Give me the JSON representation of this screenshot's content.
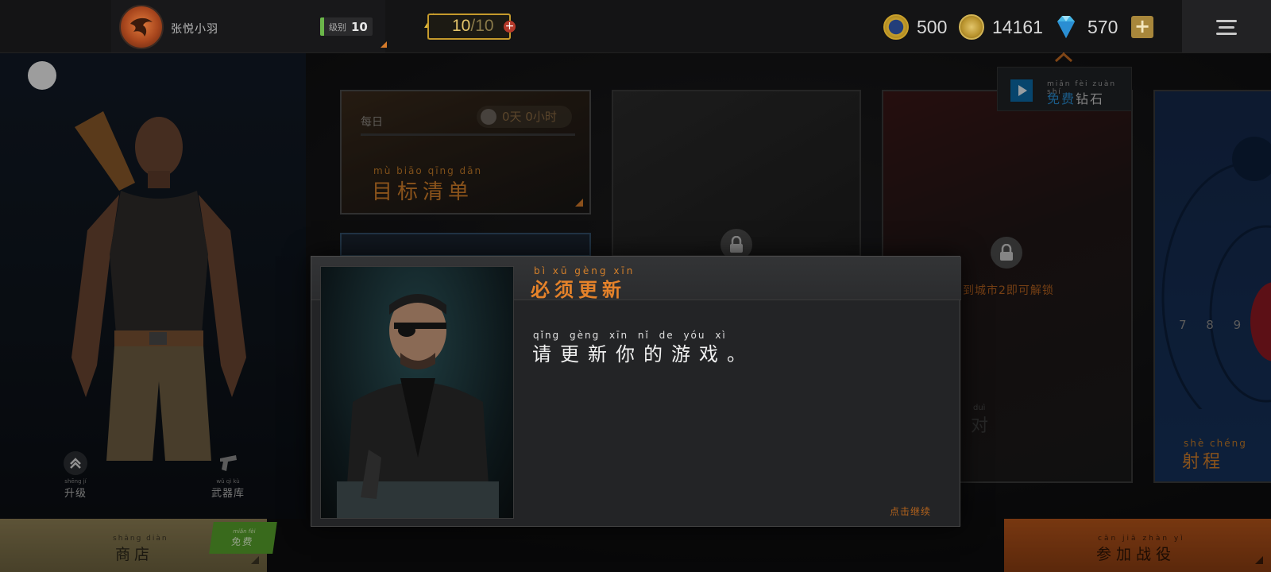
{
  "topbar": {
    "username": "张悦小羽",
    "level_label": "级别",
    "level_value": "10",
    "energy_current": "10",
    "energy_sep": "/",
    "energy_max": "10",
    "currency_skull": "500",
    "currency_gold": "14161",
    "currency_gems": "570",
    "add_label": "+"
  },
  "free_gems": {
    "pinyin": "miǎn fèi  zuàn shí",
    "free": "免费",
    "gem": "钻石"
  },
  "left_panel": {
    "upgrade_pinyin": "shēng jí",
    "upgrade_label": "升级",
    "armory_pinyin": "wǔ qì kù",
    "armory_label": "武器库"
  },
  "cards": {
    "targets_daily": "每日",
    "targets_timer": "0天 0小时",
    "targets_pinyin": "mù biāo qīng dān",
    "targets_title": "目标清单",
    "sniper_unlock": "到城市2即可解锁",
    "sniper_dui_pinyin": "duì",
    "sniper_dui": "对",
    "range_pinyin": "shè chéng",
    "range_title": "射程",
    "range_nums": "7 8 9"
  },
  "bottom": {
    "shop_pinyin": "shāng diàn",
    "shop_label": "商店",
    "free_tag_pinyin": "miǎn fèi",
    "free_tag_label": "免费",
    "battle_pinyin": "cān jiā zhàn yì",
    "battle_label": "参加战役"
  },
  "modal": {
    "title_pinyin": "bì xū gèng xīn",
    "title": "必须更新",
    "message_pinyin": "qǐng gèng xīn nǐ de yóu xì",
    "message": "请更新你的游戏。",
    "continue": "点击继续"
  },
  "colors": {
    "accent_orange": "#d5802a",
    "free_blue": "#2a8ed3",
    "level_green": "#6bb64a"
  }
}
